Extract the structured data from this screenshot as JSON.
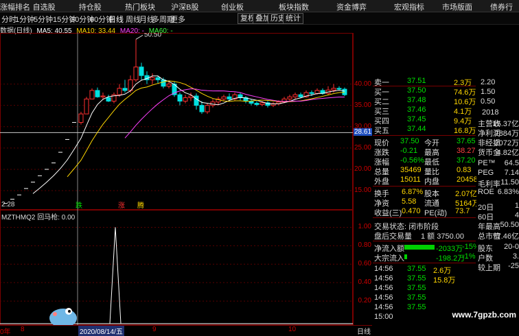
{
  "topnav": {
    "items": [
      "涨幅排名",
      "自选股",
      "持仓股",
      "热门板块",
      "沪深B股",
      "创业板",
      "板块指数",
      "资金博弈",
      "宏观指标",
      "市场版面",
      "债券行"
    ]
  },
  "periods": {
    "items": [
      "分时",
      "1分钟",
      "5分钟",
      "15分钟",
      "30分钟",
      "60分钟",
      "日线",
      "周线",
      "月线",
      "多周期",
      "更多"
    ],
    "active": "日线",
    "buttons": [
      "复权",
      "叠加",
      "历史",
      "统计"
    ]
  },
  "ma_legend": {
    "title": "数据(日线)",
    "ma5": "MA5: 40.55",
    "ma10": "MA10: 33.44",
    "ma20": "MA20: -",
    "ma60": "MA60: -"
  },
  "main_chart": {
    "peak_label": "50.50",
    "low_label": "2.28",
    "current_price_label": "28.61",
    "signal_labels": [
      "跌",
      "涨",
      "腾"
    ],
    "ticks": [
      "40.00",
      "35.00",
      "30.00",
      "25.00",
      "20.00",
      "15.00"
    ],
    "candles": [
      {
        "o": 31.0,
        "c": 33.0,
        "h": 33.5,
        "l": 30.5
      },
      {
        "o": 33.0,
        "c": 36.5,
        "h": 37.0,
        "l": 33.0
      },
      {
        "o": 36.5,
        "c": 38.5,
        "h": 39.0,
        "l": 36.5
      },
      {
        "o": 38.5,
        "c": 37.0,
        "h": 39.2,
        "l": 36.8
      },
      {
        "o": 37.0,
        "c": 37.2,
        "h": 38.0,
        "l": 36.5
      },
      {
        "o": 36.8,
        "c": 36.0,
        "h": 37.5,
        "l": 35.8
      },
      {
        "o": 36.0,
        "c": 37.5,
        "h": 38.0,
        "l": 35.5
      },
      {
        "o": 37.5,
        "c": 39.0,
        "h": 40.0,
        "l": 37.0
      },
      {
        "o": 39.0,
        "c": 38.5,
        "h": 41.0,
        "l": 38.0
      },
      {
        "o": 38.5,
        "c": 41.0,
        "h": 42.0,
        "l": 38.0
      },
      {
        "o": 41.0,
        "c": 44.0,
        "h": 50.5,
        "l": 40.5
      },
      {
        "o": 44.0,
        "c": 42.0,
        "h": 45.0,
        "l": 41.0
      },
      {
        "o": 42.0,
        "c": 41.0,
        "h": 43.0,
        "l": 40.0
      },
      {
        "o": 41.0,
        "c": 41.5,
        "h": 42.5,
        "l": 40.0
      },
      {
        "o": 41.5,
        "c": 41.0,
        "h": 42.0,
        "l": 40.2
      },
      {
        "o": 41.0,
        "c": 39.5,
        "h": 41.5,
        "l": 39.0
      },
      {
        "o": 39.5,
        "c": 40.0,
        "h": 40.8,
        "l": 39.0
      },
      {
        "o": 40.0,
        "c": 37.5,
        "h": 40.5,
        "l": 37.0
      },
      {
        "o": 37.5,
        "c": 36.0,
        "h": 38.0,
        "l": 35.0
      },
      {
        "o": 36.0,
        "c": 36.8,
        "h": 37.5,
        "l": 35.5
      },
      {
        "o": 36.8,
        "c": 37.2,
        "h": 38.0,
        "l": 36.0
      },
      {
        "o": 37.2,
        "c": 35.0,
        "h": 37.8,
        "l": 34.0
      },
      {
        "o": 35.0,
        "c": 33.5,
        "h": 36.0,
        "l": 33.0
      },
      {
        "o": 33.5,
        "c": 35.0,
        "h": 35.5,
        "l": 33.0
      },
      {
        "o": 35.0,
        "c": 35.8,
        "h": 36.5,
        "l": 34.5
      },
      {
        "o": 35.8,
        "c": 36.5,
        "h": 37.0,
        "l": 35.0
      },
      {
        "o": 36.5,
        "c": 37.0,
        "h": 37.5,
        "l": 36.0
      },
      {
        "o": 37.0,
        "c": 36.5,
        "h": 37.8,
        "l": 36.0
      },
      {
        "o": 36.5,
        "c": 37.5,
        "h": 38.0,
        "l": 36.0
      },
      {
        "o": 37.5,
        "c": 36.8,
        "h": 38.0,
        "l": 36.2
      },
      {
        "o": 36.8,
        "c": 36.0,
        "h": 37.2,
        "l": 35.5
      },
      {
        "o": 36.0,
        "c": 35.5,
        "h": 36.5,
        "l": 35.0
      },
      {
        "o": 35.5,
        "c": 35.2,
        "h": 36.0,
        "l": 34.8
      },
      {
        "o": 35.2,
        "c": 35.6,
        "h": 36.0,
        "l": 34.8
      },
      {
        "o": 35.6,
        "c": 35.0,
        "h": 36.0,
        "l": 34.5
      },
      {
        "o": 35.0,
        "c": 35.4,
        "h": 35.8,
        "l": 34.6
      },
      {
        "o": 35.4,
        "c": 35.8,
        "h": 36.2,
        "l": 35.0
      },
      {
        "o": 35.8,
        "c": 36.5,
        "h": 37.0,
        "l": 35.5
      },
      {
        "o": 36.5,
        "c": 37.0,
        "h": 37.5,
        "l": 36.0
      },
      {
        "o": 37.0,
        "c": 37.5,
        "h": 38.0,
        "l": 36.5
      },
      {
        "o": 37.5,
        "c": 37.0,
        "h": 38.0,
        "l": 36.8
      },
      {
        "o": 37.0,
        "c": 38.0,
        "h": 38.5,
        "l": 36.8
      },
      {
        "o": 38.0,
        "c": 37.8,
        "h": 38.5,
        "l": 37.2
      },
      {
        "o": 37.8,
        "c": 38.5,
        "h": 39.0,
        "l": 37.5
      },
      {
        "o": 38.5,
        "c": 37.8,
        "h": 39.0,
        "l": 37.5
      },
      {
        "o": 37.8,
        "c": 38.6,
        "h": 39.5,
        "l": 37.5
      },
      {
        "o": 38.6,
        "c": 39.0,
        "h": 40.0,
        "l": 38.0
      },
      {
        "o": 39.0,
        "c": 38.8,
        "h": 39.5,
        "l": 38.5
      },
      {
        "o": 38.8,
        "c": 37.5,
        "h": 39.2,
        "l": 37.2
      }
    ]
  },
  "sub_chart": {
    "title": "MZTHMQ2 回马枪: 0.00",
    "ticks": [
      "1.00",
      "0.80",
      "0.60",
      "0.40",
      "0.20"
    ]
  },
  "bottom_axis": {
    "date": "2020/08/14/五",
    "labels": [
      "0年",
      "8",
      "9",
      "10",
      "日线"
    ]
  },
  "order_book": {
    "sell1": {
      "label": "卖一",
      "price": "37.51",
      "vol": "2.3万"
    },
    "buy": [
      {
        "label": "买一",
        "price": "37.50",
        "vol": "74.6万"
      },
      {
        "label": "买二",
        "price": "37.48",
        "vol": "10.6万"
      },
      {
        "label": "买三",
        "price": "37.46",
        "vol": "4.1万"
      },
      {
        "label": "买四",
        "price": "37.45",
        "vol": "9.4万"
      },
      {
        "label": "买五",
        "price": "37.44",
        "vol": "16.8万"
      }
    ]
  },
  "quote": {
    "rows": [
      {
        "l1": "现价",
        "v1": "37.50",
        "l2": "今开",
        "v2": "37.65"
      },
      {
        "l1": "涨跌",
        "v1": "-0.21",
        "l2": "最高",
        "v2": "38.27"
      },
      {
        "l1": "涨幅",
        "v1": "-0.56%",
        "l2": "最低",
        "v2": "37.20"
      },
      {
        "l1": "总量",
        "v1": "35469",
        "l2": "量比",
        "v2": "0.83"
      },
      {
        "l1": "外盘",
        "v1": "15011",
        "l2": "内盘",
        "v2": "20458"
      }
    ]
  },
  "fundamentals": {
    "rows": [
      {
        "l1": "换手",
        "v1": "6.87%",
        "l2": "股本",
        "v2": "2.07亿"
      },
      {
        "l1": "净资",
        "v1": "5.58",
        "l2": "流通",
        "v2": "5164万"
      },
      {
        "l1": "收益(三)",
        "v1": "0.470",
        "l2": "PE(动)",
        "v2": "73.7"
      }
    ]
  },
  "trade_status": {
    "line1": "交易状态: 闭市阶段",
    "line2_label": "盘后交易量",
    "line2_value": "1 额 3750.00"
  },
  "flows": [
    {
      "label": "净流入额",
      "value": "-2033万",
      "pct": "-15%",
      "bar": 0.55
    },
    {
      "label": "大宗流入",
      "value": "-198.2万",
      "pct": "-1%",
      "bar": 0.05
    }
  ],
  "ticks_list": [
    {
      "time": "14:56",
      "price": "37.55",
      "vol": "2.6万"
    },
    {
      "time": "14:56",
      "price": "37.55",
      "vol": "15.8万"
    },
    {
      "time": "14:56",
      "price": "37.55",
      "vol": ""
    },
    {
      "time": "14:56",
      "price": "37.55",
      "vol": ""
    },
    {
      "time": "14:56",
      "price": "37.55",
      "vol": ""
    },
    {
      "time": "15:00",
      "price": "",
      "vol": ""
    }
  ],
  "far_right": {
    "top": [
      "2.20",
      "1.50",
      "0.50"
    ],
    "year": "2018",
    "rows": [
      {
        "l": "主营收",
        "v": "15.37亿"
      },
      {
        "l": "净利润",
        "v": "7884万"
      },
      {
        "l": "非经损",
        "v": "2072万"
      },
      {
        "l": "货币金",
        "v": "4.82亿"
      }
    ],
    "rows2": [
      {
        "l": "PE™",
        "v": "64.5"
      },
      {
        "l": "PEG",
        "v": "7.14"
      },
      {
        "l": "毛利率",
        "v": "11.50"
      },
      {
        "l": "ROE",
        "v": "6.83%"
      }
    ],
    "rows3": [
      {
        "l": "20日",
        "v": "1"
      },
      {
        "l": "60日",
        "v": "4"
      },
      {
        "l": "年最高",
        "v": "50.50"
      },
      {
        "l": "总市值",
        "v": "77.46亿"
      }
    ],
    "rows4": [
      {
        "l": "股东",
        "v": "20-0"
      },
      {
        "l": "户数",
        "v": "3."
      },
      {
        "l": "较上期",
        "v": "-25"
      }
    ]
  },
  "watermark": "www.7gpzb.com"
}
